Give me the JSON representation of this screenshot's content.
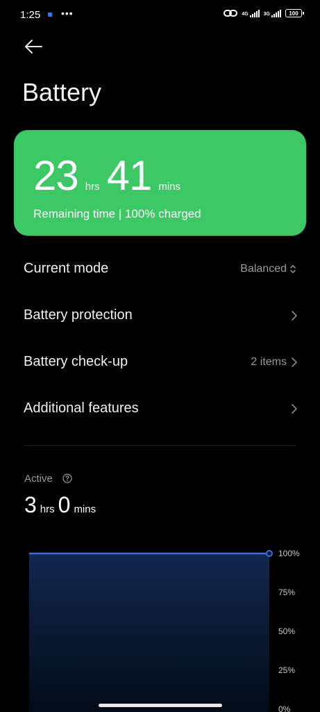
{
  "status_bar": {
    "time": "1:25",
    "more": "•••",
    "net1": "4G",
    "net2": "3G",
    "battery_level": "100"
  },
  "page": {
    "title": "Battery"
  },
  "battery_card": {
    "hours": "23",
    "hours_unit": "hrs",
    "minutes": "41",
    "minutes_unit": "mins",
    "subtitle": "Remaining time | 100% charged",
    "color": "#3cc864"
  },
  "settings": [
    {
      "label": "Current mode",
      "value": "Balanced",
      "icon": "updown-icon"
    },
    {
      "label": "Battery protection",
      "value": "",
      "icon": "chevron-right-icon"
    },
    {
      "label": "Battery check-up",
      "value": "2 items",
      "icon": "chevron-right-icon"
    },
    {
      "label": "Additional features",
      "value": "",
      "icon": "chevron-right-icon"
    }
  ],
  "active": {
    "label": "Active",
    "hours": "3",
    "hours_unit": "hrs",
    "minutes": "0",
    "minutes_unit": "mins"
  },
  "chart_data": {
    "type": "area",
    "y_ticks": [
      "100%",
      "75%",
      "50%",
      "25%",
      "0%"
    ],
    "ylim": [
      0,
      100
    ],
    "series": [
      {
        "values": [
          100,
          100
        ]
      }
    ],
    "line_color": "#3b6fe0"
  }
}
